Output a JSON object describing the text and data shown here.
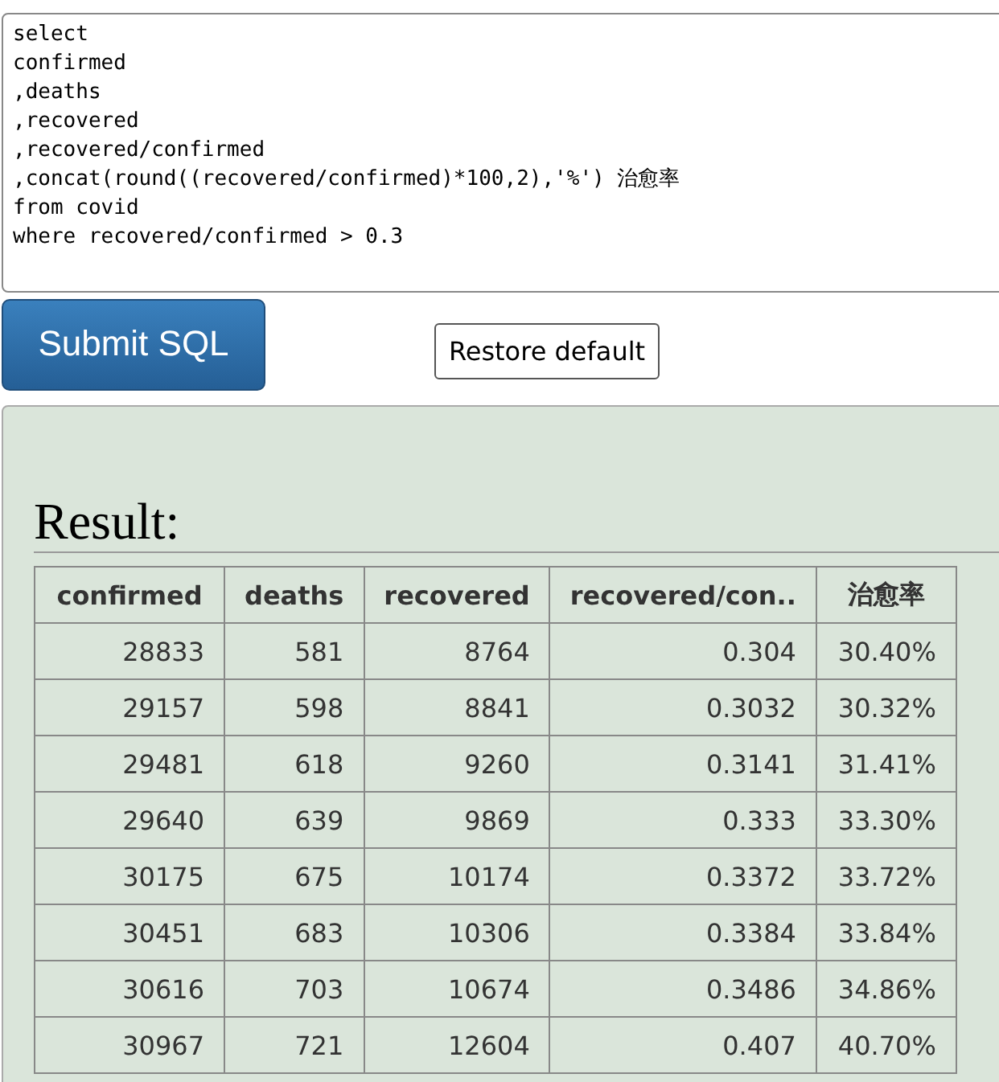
{
  "query_editor": {
    "lines": [
      "select",
      "confirmed",
      ",deaths",
      ",recovered",
      ",recovered/confirmed",
      ",concat(round((recovered/confirmed)*100,2),'%') 治愈率",
      "from covid",
      "where recovered/confirmed > 0.3"
    ]
  },
  "buttons": {
    "submit": "Submit SQL",
    "restore": "Restore default"
  },
  "result": {
    "title": "Result:",
    "table": {
      "columns": [
        "confirmed",
        "deaths",
        "recovered",
        "recovered/con..",
        "治愈率"
      ],
      "rows": [
        [
          "28833",
          "581",
          "8764",
          "0.304",
          "30.40%"
        ],
        [
          "29157",
          "598",
          "8841",
          "0.3032",
          "30.32%"
        ],
        [
          "29481",
          "618",
          "9260",
          "0.3141",
          "31.41%"
        ],
        [
          "29640",
          "639",
          "9869",
          "0.333",
          "33.30%"
        ],
        [
          "30175",
          "675",
          "10174",
          "0.3372",
          "33.72%"
        ],
        [
          "30451",
          "683",
          "10306",
          "0.3384",
          "33.84%"
        ],
        [
          "30616",
          "703",
          "10674",
          "0.3486",
          "34.86%"
        ],
        [
          "30967",
          "721",
          "12604",
          "0.407",
          "40.70%"
        ]
      ]
    }
  }
}
